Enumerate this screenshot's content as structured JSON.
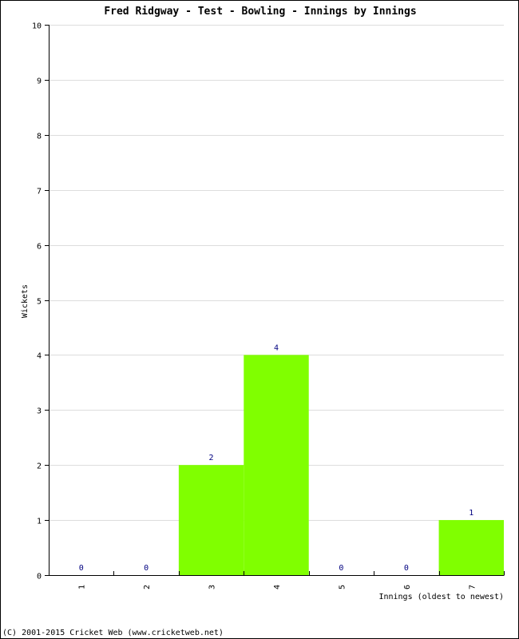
{
  "chart_data": {
    "type": "bar",
    "title": "Fred Ridgway - Test - Bowling - Innings by Innings",
    "xlabel": "Innings (oldest to newest)",
    "ylabel": "Wickets",
    "categories": [
      "1",
      "2",
      "3",
      "4",
      "5",
      "6",
      "7"
    ],
    "values": [
      0,
      0,
      2,
      4,
      0,
      0,
      1
    ],
    "ylim": [
      0,
      10
    ],
    "yticks": [
      0,
      1,
      2,
      3,
      4,
      5,
      6,
      7,
      8,
      9,
      10
    ],
    "grid": true,
    "bar_color": "#80ff00",
    "label_color": "#000080",
    "gridline_color": "#dddddd"
  },
  "footer": "(C) 2001-2015 Cricket Web (www.cricketweb.net)"
}
